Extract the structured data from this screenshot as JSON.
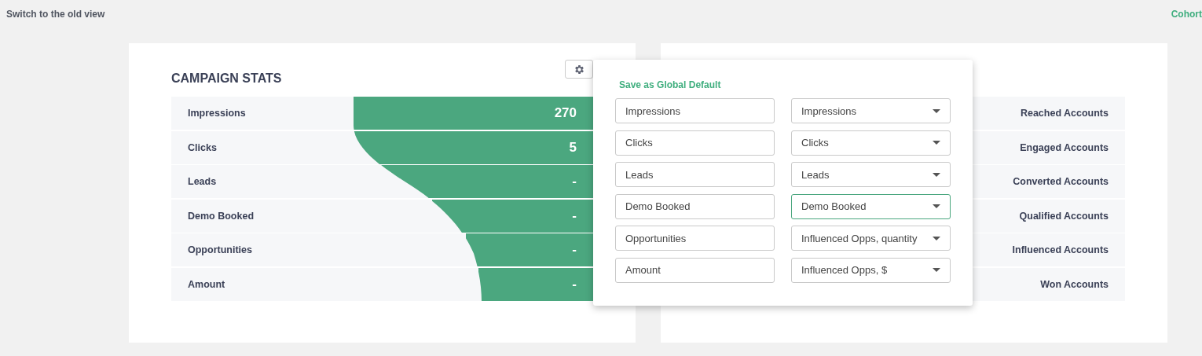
{
  "top_bar": {
    "switch_link": "Switch to the old view",
    "cohort_link": "Cohort"
  },
  "campaign_stats": {
    "title": "CAMPAIGN STATS",
    "rows": [
      {
        "label": "Impressions",
        "value": "270"
      },
      {
        "label": "Clicks",
        "value": "5"
      },
      {
        "label": "Leads",
        "value": "-"
      },
      {
        "label": "Demo Booked",
        "value": "-"
      },
      {
        "label": "Opportunities",
        "value": "-"
      },
      {
        "label": "Amount",
        "value": "-"
      }
    ]
  },
  "accounts": {
    "rows": [
      {
        "label": "Reached Accounts"
      },
      {
        "label": "Engaged Accounts"
      },
      {
        "label": "Converted Accounts"
      },
      {
        "label": "Qualified Accounts"
      },
      {
        "label": "Influenced Accounts"
      },
      {
        "label": "Won Accounts"
      }
    ]
  },
  "settings_popup": {
    "save_link": "Save as Global Default",
    "mappings": [
      {
        "name": "Impressions",
        "metric": "Impressions",
        "focused": false
      },
      {
        "name": "Clicks",
        "metric": "Clicks",
        "focused": false
      },
      {
        "name": "Leads",
        "metric": "Leads",
        "focused": false
      },
      {
        "name": "Demo Booked",
        "metric": "Demo Booked",
        "focused": true
      },
      {
        "name": "Opportunities",
        "metric": "Influenced Opps, quantity",
        "focused": false
      },
      {
        "name": "Amount",
        "metric": "Influenced Opps, $",
        "focused": false
      }
    ]
  }
}
